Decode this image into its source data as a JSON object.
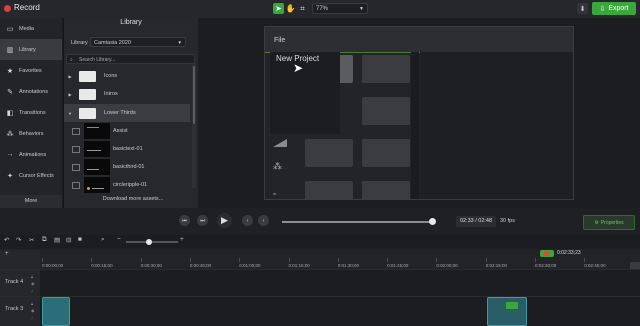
{
  "app": {
    "record_label": "Record",
    "zoom": "77%",
    "export_label": "Export"
  },
  "nav": {
    "items": [
      {
        "label": "Media",
        "icon": "media-icon"
      },
      {
        "label": "Library",
        "icon": "library-icon"
      },
      {
        "label": "Favorites",
        "icon": "star-icon"
      },
      {
        "label": "Annotations",
        "icon": "annotation-icon"
      },
      {
        "label": "Transitions",
        "icon": "transition-icon"
      },
      {
        "label": "Behaviors",
        "icon": "behaviors-icon"
      },
      {
        "label": "Animations",
        "icon": "animation-icon"
      },
      {
        "label": "Cursor Effects",
        "icon": "cursor-effects-icon"
      }
    ],
    "more_label": "More"
  },
  "library": {
    "title": "Library",
    "select_label": "Library",
    "select_value": "Camtasia 2020",
    "search_placeholder": "Search Library...",
    "folders": [
      "Icons",
      "Intros",
      "Lower Thirds"
    ],
    "assets": [
      "Assist",
      "basictext-01",
      "basicthird-01",
      "circleripple-01"
    ],
    "download_label": "Download more assets..."
  },
  "canvas": {
    "menu_file": "File",
    "new_project": "New Project"
  },
  "player": {
    "time": "02:33 / 02:48",
    "fps": "30 fps",
    "properties_label": "Properties"
  },
  "timeline": {
    "playhead_time": "0:02:33;23",
    "ruler": [
      "0:00:00;00",
      "0:00:15;00",
      "0:00:30;00",
      "0:00:45;00",
      "0:01:00;00",
      "0:01:15;00",
      "0:01:30;00",
      "0:01:45;00",
      "0:02:00;00",
      "0:02:15;00",
      "0:02:30;00",
      "0:02:45;00"
    ],
    "tracks": [
      "Track 4",
      "Track 3"
    ]
  },
  "colors": {
    "accent": "#3aa63c",
    "record": "#e23b3b"
  }
}
